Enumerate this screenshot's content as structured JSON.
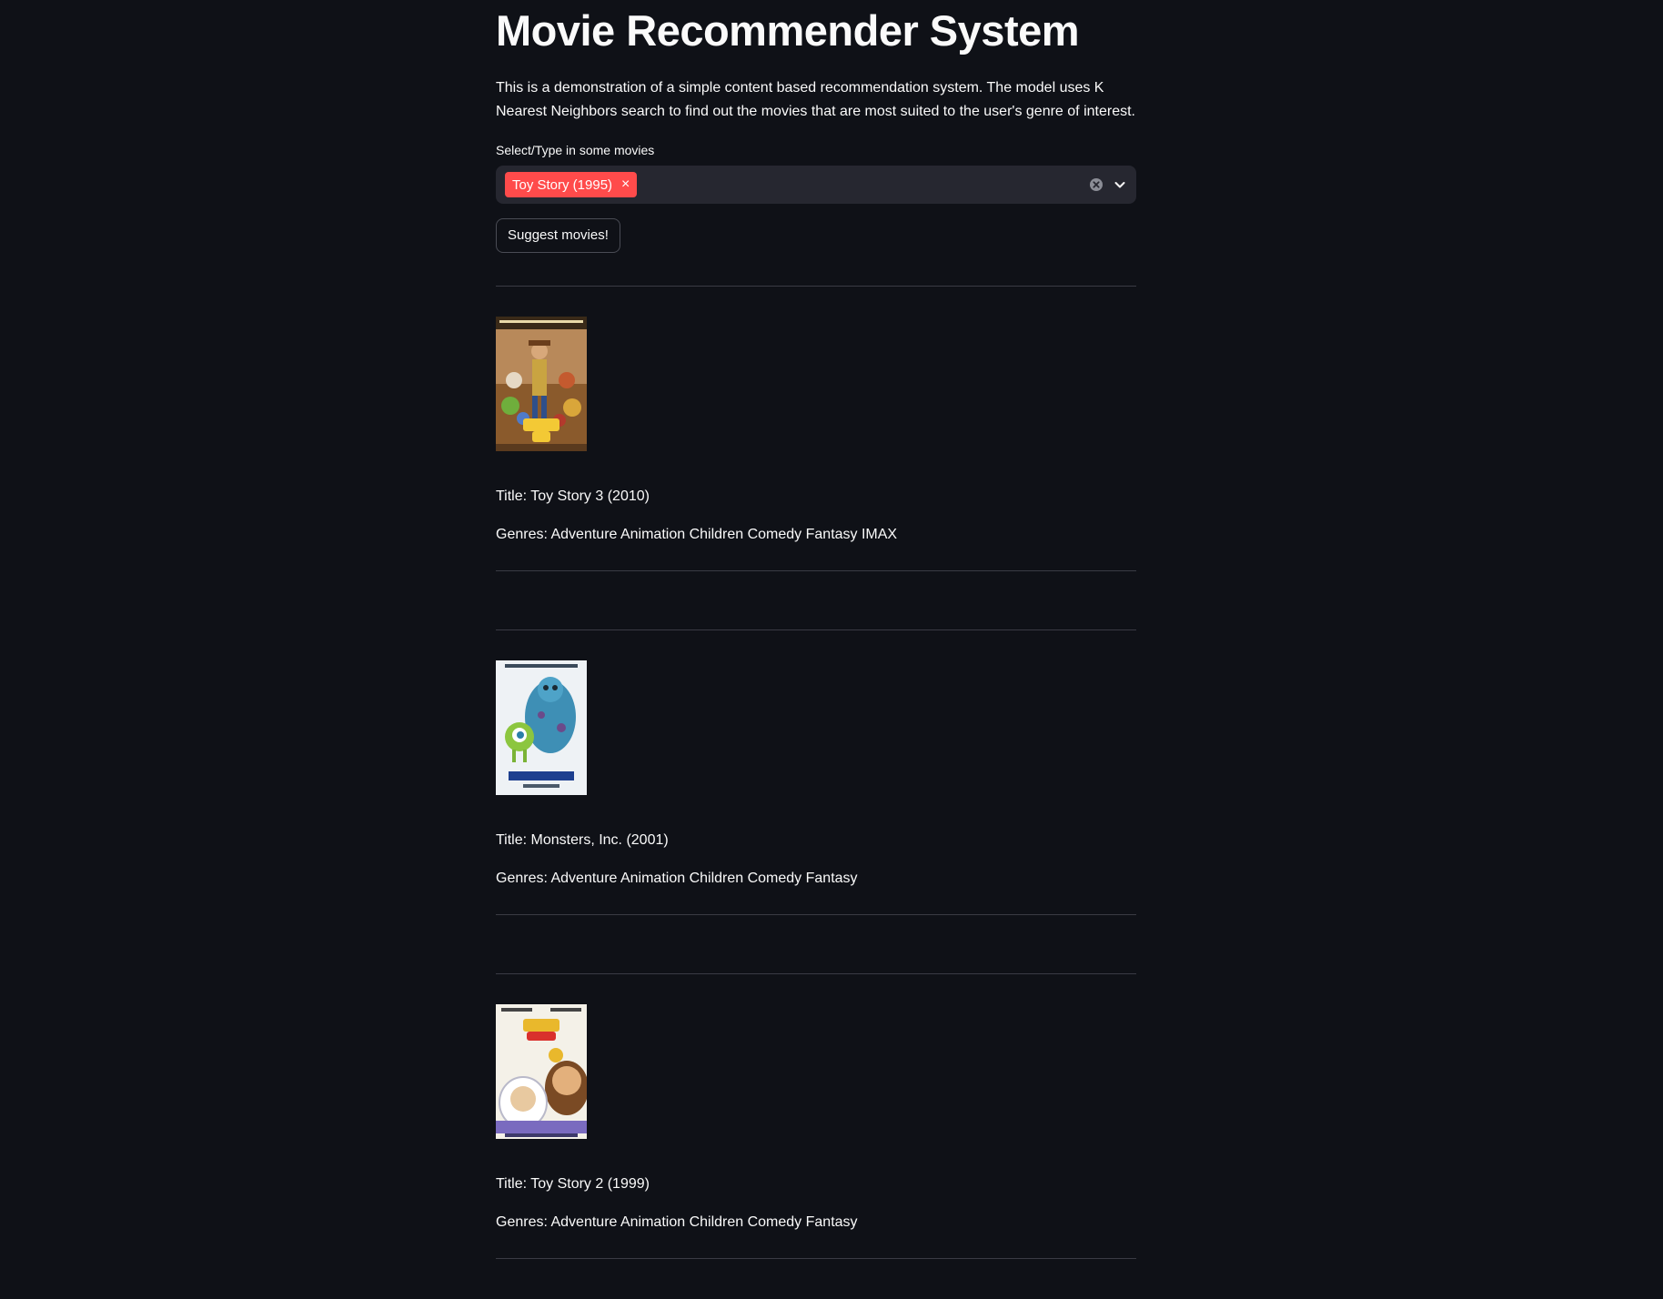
{
  "header": {
    "title": "Movie Recommender System",
    "description": "This is a demonstration of a simple content based recommendation system. The model uses K Nearest Neighbors search to find out the movies that are most suited to the user's genre of interest."
  },
  "select": {
    "label": "Select/Type in some movies",
    "selected": [
      "Toy Story (1995)"
    ],
    "remove_tag_glyph": "×",
    "clear_icon": "clear-circle-icon",
    "dropdown_icon": "chevron-down-icon"
  },
  "suggest_button": {
    "label": "Suggest movies!"
  },
  "colors": {
    "background": "#0f1117",
    "accent": "#ff4b4b",
    "input_bg": "#262730"
  },
  "recommendations": [
    {
      "title": "Title: Toy Story 3 (2010)",
      "genres": "Genres: Adventure Animation Children Comedy Fantasy IMAX",
      "poster_icon": "toy-story-3-poster"
    },
    {
      "title": "Title: Monsters, Inc. (2001)",
      "genres": "Genres: Adventure Animation Children Comedy Fantasy",
      "poster_icon": "monsters-inc-poster"
    },
    {
      "title": "Title: Toy Story 2 (1999)",
      "genres": "Genres: Adventure Animation Children Comedy Fantasy",
      "poster_icon": "toy-story-2-poster"
    }
  ]
}
